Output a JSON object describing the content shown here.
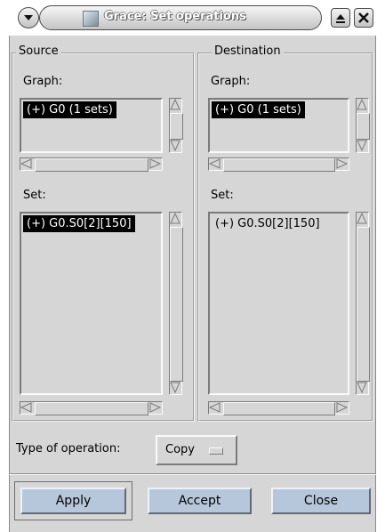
{
  "window": {
    "title": "Grace: Set operations",
    "icons": {
      "menu": "chevron-down-icon",
      "app": "grace-app-icon",
      "maximize": "eject-icon",
      "close": "close-icon"
    }
  },
  "source": {
    "label": "Source",
    "graph_label": "Graph:",
    "graph_items": [
      "(+) G0 (1 sets)"
    ],
    "set_label": "Set:",
    "set_items": [
      "(+) G0.S0[2][150]"
    ]
  },
  "destination": {
    "label": "Destination",
    "graph_label": "Graph:",
    "graph_items": [
      "(+) G0 (1 sets)"
    ],
    "set_label": "Set:",
    "set_items": [
      "(+) G0.S0[2][150]"
    ]
  },
  "operation": {
    "label": "Type of operation:",
    "value": "Copy"
  },
  "buttons": {
    "apply": "Apply",
    "accept": "Accept",
    "close": "Close"
  },
  "colors": {
    "background": "#d6d6d6",
    "button": "#b7c7db",
    "selection": "#000000"
  }
}
